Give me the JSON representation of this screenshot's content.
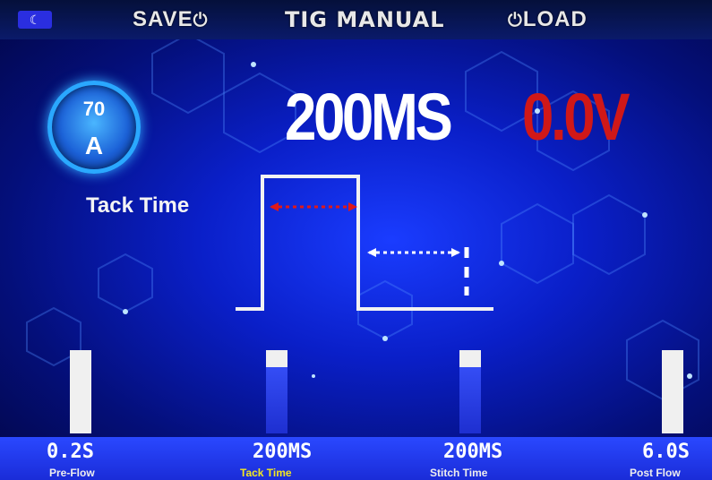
{
  "header": {
    "back_glyph": "☾",
    "save_label": "SAVE",
    "save_icon": "power-icon",
    "title": "TIG MANUAL",
    "load_icon": "power-icon",
    "load_label": "LOAD"
  },
  "dial": {
    "value": "70",
    "unit": "A"
  },
  "readout": {
    "main": "200MS",
    "voltage": "0.0V"
  },
  "active_param": "Tack Time",
  "colors": {
    "accent": "#2a48ff",
    "voltage": "#d01818",
    "active_label": "#f4e820"
  },
  "params": [
    {
      "value": "0.2S",
      "label": "Pre-Flow",
      "level": 1.0
    },
    {
      "value": "200MS",
      "label": "Tack Time",
      "level": 0.2,
      "active": true
    },
    {
      "value": "200MS",
      "label": "Stitch Time",
      "level": 0.2
    },
    {
      "value": "6.0S",
      "label": "Post Flow",
      "level": 1.0
    }
  ]
}
